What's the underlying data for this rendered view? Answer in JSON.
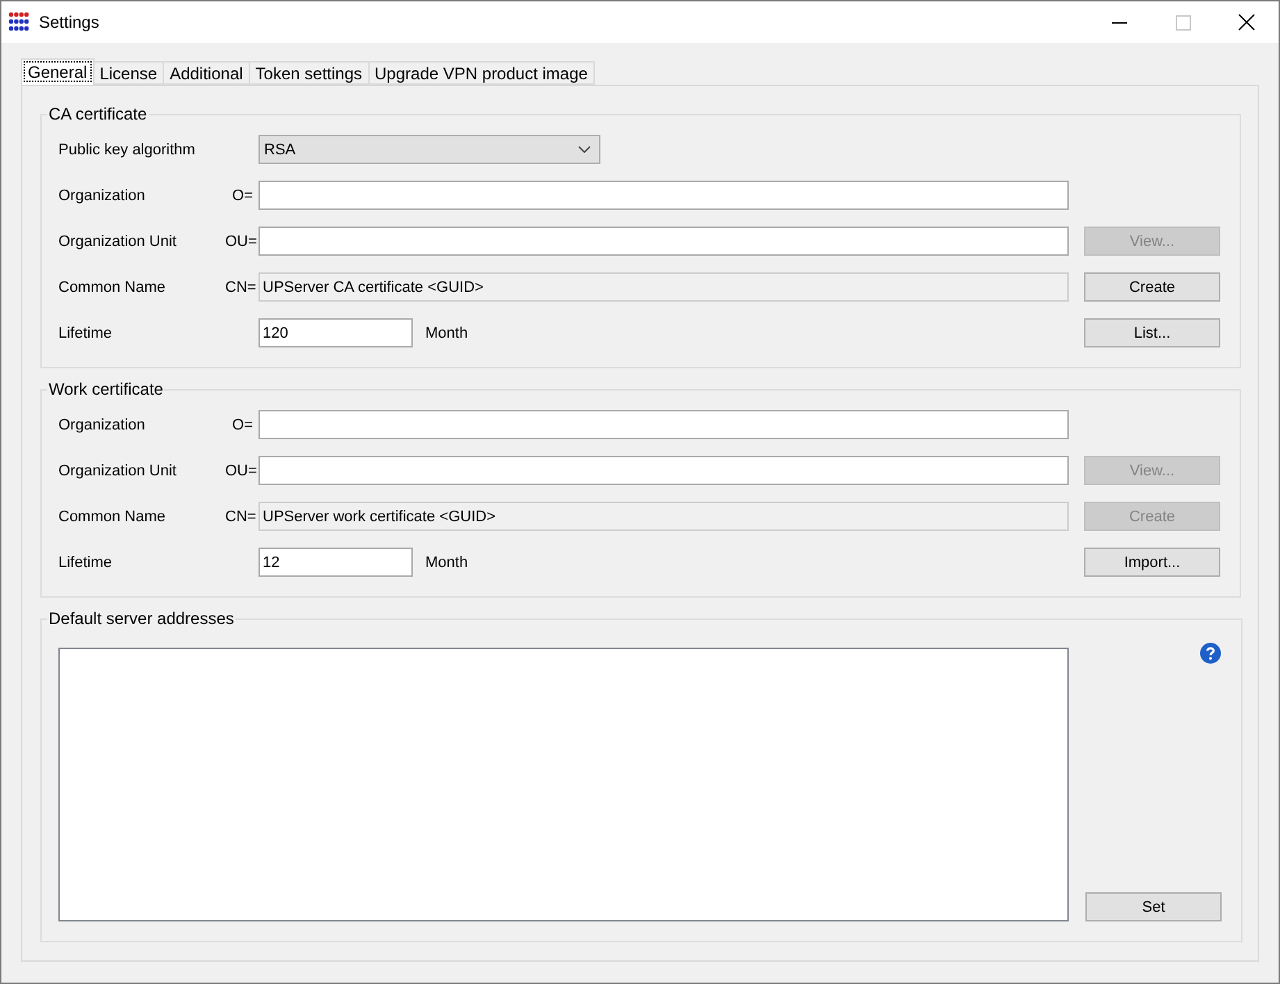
{
  "window": {
    "title": "Settings"
  },
  "tabs": [
    {
      "label": "General",
      "selected": true
    },
    {
      "label": "License",
      "selected": false
    },
    {
      "label": "Additional",
      "selected": false
    },
    {
      "label": "Token settings",
      "selected": false
    },
    {
      "label": "Upgrade VPN product image",
      "selected": false
    }
  ],
  "groups": [
    {
      "title": "CA certificate",
      "rows": [
        {
          "kind": "select",
          "label": "Public key algorithm",
          "value": "RSA"
        },
        {
          "kind": "text",
          "label": "Organization",
          "prefix": "O=",
          "readonly": false
        },
        {
          "kind": "text",
          "label": "Organization Unit",
          "prefix": "OU=",
          "readonly": false,
          "button": {
            "label": "View...",
            "disabled": true
          }
        },
        {
          "kind": "text",
          "label": "Common Name",
          "prefix": "CN=",
          "value": "UPServer CA certificate <GUID>",
          "readonly": true,
          "button": {
            "label": "Create",
            "disabled": false
          }
        },
        {
          "kind": "number",
          "label": "Lifetime",
          "value": "120",
          "unit": "Month",
          "button": {
            "label": "List...",
            "disabled": false
          }
        }
      ]
    },
    {
      "title": "Work certificate",
      "rows": [
        {
          "kind": "text",
          "label": "Organization",
          "prefix": "O=",
          "readonly": false
        },
        {
          "kind": "text",
          "label": "Organization Unit",
          "prefix": "OU=",
          "readonly": false,
          "button": {
            "label": "View...",
            "disabled": true
          }
        },
        {
          "kind": "text",
          "label": "Common Name",
          "prefix": "CN=",
          "value": "UPServer work certificate <GUID>",
          "readonly": true,
          "button": {
            "label": "Create",
            "disabled": true
          }
        },
        {
          "kind": "number",
          "label": "Lifetime",
          "value": "12",
          "unit": "Month",
          "button": {
            "label": "Import...",
            "disabled": false
          }
        }
      ]
    }
  ],
  "server_addresses": {
    "title": "Default server addresses",
    "button": {
      "label": "Set",
      "disabled": false
    }
  }
}
